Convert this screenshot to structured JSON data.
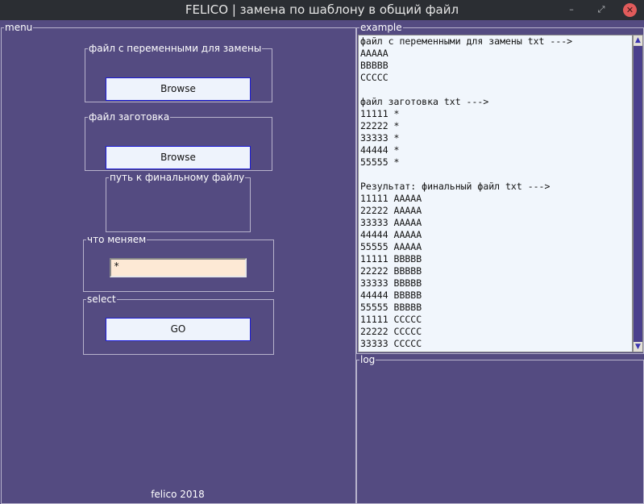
{
  "window": {
    "title": "FELICO | замена по шаблону в общий файл",
    "controls": [
      "minimize-icon",
      "maximize-icon",
      "close-icon"
    ]
  },
  "menu": {
    "legend": "menu",
    "vars_file": {
      "legend": "файл с переменными для замены",
      "button": "Browse"
    },
    "template_file": {
      "legend": "файл заготовка",
      "button": "Browse"
    },
    "final_path": {
      "legend": "путь к финальному файлу",
      "value": ""
    },
    "replace": {
      "legend": "что меняем",
      "value": "*"
    },
    "select": {
      "legend": "select",
      "button": "GO"
    },
    "footer": "felico 2018"
  },
  "example": {
    "legend": "example",
    "lines": [
      "файл с переменными для замены txt --->",
      "AAAAA",
      "BBBBB",
      "CCCCC",
      "",
      "файл заготовка txt --->",
      "11111 *",
      "22222 *",
      "33333 *",
      "44444 *",
      "55555 *",
      "",
      "Результат: финальный файл txt --->",
      "11111 AAAAA",
      "22222 AAAAA",
      "33333 AAAAA",
      "44444 AAAAA",
      "55555 AAAAA",
      "11111 BBBBB",
      "22222 BBBBB",
      "33333 BBBBB",
      "44444 BBBBB",
      "55555 BBBBB",
      "11111 CCCCC",
      "22222 CCCCC",
      "33333 CCCCC"
    ]
  },
  "log": {
    "legend": "log"
  },
  "colors": {
    "background": "#544b81",
    "button_bg": "#eef3fc",
    "button_border": "#1a1ad6",
    "entry_bg": "#fde9d5",
    "textarea_bg": "#f1f6fc",
    "close_button": "#e15b5b"
  }
}
